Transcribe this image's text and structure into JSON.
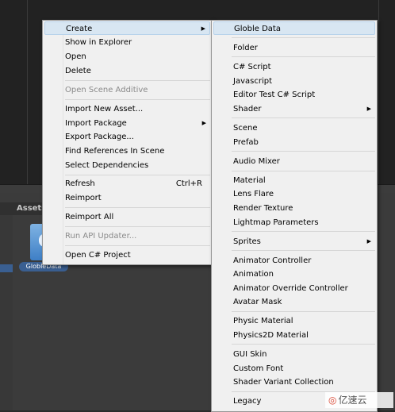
{
  "project_panel": {
    "assets_tab": "Assets",
    "asset_name": "GlobleData",
    "asset_icon_glyph": "C"
  },
  "context_menu": {
    "items": [
      {
        "label": "Create",
        "submenu": true,
        "highlighted": true
      },
      {
        "label": "Show in Explorer"
      },
      {
        "label": "Open"
      },
      {
        "label": "Delete"
      },
      {
        "label": "Open Scene Additive",
        "disabled": true
      },
      {
        "label": "Import New Asset..."
      },
      {
        "label": "Import Package",
        "submenu": true
      },
      {
        "label": "Export Package..."
      },
      {
        "label": "Find References In Scene"
      },
      {
        "label": "Select Dependencies"
      },
      {
        "label": "Refresh",
        "shortcut": "Ctrl+R"
      },
      {
        "label": "Reimport"
      },
      {
        "label": "Reimport All"
      },
      {
        "label": "Run API Updater...",
        "disabled": true
      },
      {
        "label": "Open C# Project"
      }
    ]
  },
  "create_menu": {
    "items": [
      {
        "label": "Globle Data",
        "highlighted": true
      },
      {
        "label": "Folder"
      },
      {
        "label": "C# Script"
      },
      {
        "label": "Javascript"
      },
      {
        "label": "Editor Test C# Script"
      },
      {
        "label": "Shader",
        "submenu": true
      },
      {
        "label": "Scene"
      },
      {
        "label": "Prefab"
      },
      {
        "label": "Audio Mixer"
      },
      {
        "label": "Material"
      },
      {
        "label": "Lens Flare"
      },
      {
        "label": "Render Texture"
      },
      {
        "label": "Lightmap Parameters"
      },
      {
        "label": "Sprites",
        "submenu": true
      },
      {
        "label": "Animator Controller"
      },
      {
        "label": "Animation"
      },
      {
        "label": "Animator Override Controller"
      },
      {
        "label": "Avatar Mask"
      },
      {
        "label": "Physic Material"
      },
      {
        "label": "Physics2D Material"
      },
      {
        "label": "GUI Skin"
      },
      {
        "label": "Custom Font"
      },
      {
        "label": "Shader Variant Collection"
      },
      {
        "label": "Legacy"
      }
    ]
  },
  "icons": {
    "submenu_arrow": "▶"
  },
  "watermark": {
    "logo": "◎",
    "text": "亿速云"
  },
  "colors": {
    "menu_bg": "#f0f0f0",
    "highlight_bg": "#d8e6f2",
    "editor_dark": "#222222",
    "asset_selection": "#3a5f91"
  }
}
